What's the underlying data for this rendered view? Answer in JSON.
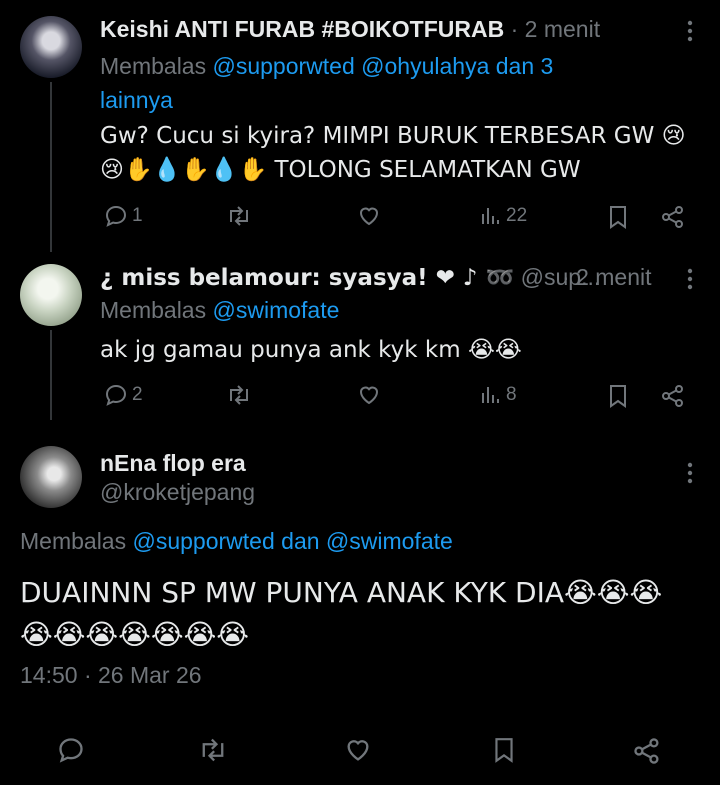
{
  "tweets": [
    {
      "name": "Keishi ANTI FURAB #BOIKOTFURAB",
      "time_sep": "·",
      "time": "2 menit",
      "reply_prefix": "Membalas",
      "reply_to_1": "@supporwted",
      "reply_to_2": "@ohyulahya dan 3",
      "reply_to_3": "lainnya",
      "line1": "Gw? Cucu si kyira? MIMPI BURUK TERBESAR GW 😢",
      "line2": "😢✋💧✋💧✋ TOLONG SELAMATKAN GW",
      "reply_count": "1",
      "retweet_count": "",
      "like_count": "",
      "view_count": "22"
    },
    {
      "name": "¿ miss belamour: syasya! ❤ ♪ ➿",
      "handle": "@sup...",
      "time_sep": "·",
      "time": "2 menit",
      "reply_prefix": "Membalas",
      "reply_to_1": "@swimofate",
      "line1": "ak jg gamau punya ank kyk km 😭😭",
      "reply_count": "2",
      "retweet_count": "",
      "like_count": "",
      "view_count": "8"
    }
  ],
  "main": {
    "name": "nEna flop era",
    "handle": "@kroketjepang",
    "reply_prefix": "Membalas",
    "reply_to": "@supporwted dan @swimofate",
    "line1": "DUAINNN SP MW PUNYA ANAK KYK DIA😭😭😭",
    "line2": "😭😭😭😭😭😭😭",
    "timestamp": "14:50 · 26 Mar 26"
  }
}
